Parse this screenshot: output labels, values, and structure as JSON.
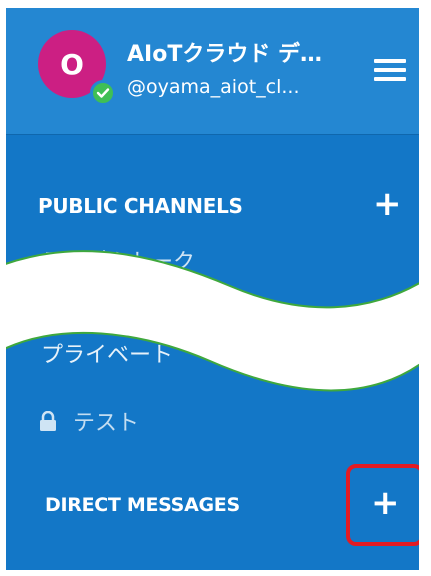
{
  "header": {
    "avatar_initial": "O",
    "team_name": "AIoTクラウド デ…",
    "handle": "@oyama_aiot_cl...",
    "status": "online"
  },
  "sidebar": {
    "public_channels": {
      "title": "PUBLIC CHANNELS",
      "add_label": "+",
      "partial_item": "ランダムトーク"
    },
    "private_channels": {
      "partial_item": "プライベート",
      "items": [
        {
          "icon": "lock-icon",
          "label": "テスト"
        }
      ]
    },
    "direct_messages": {
      "title": "DIRECT MESSAGES",
      "add_label": "+"
    }
  },
  "colors": {
    "sidebar": "#1377c7",
    "header": "#2487d2",
    "avatar": "#cc1f83",
    "online": "#3fbf55",
    "highlight": "#e31b23"
  }
}
